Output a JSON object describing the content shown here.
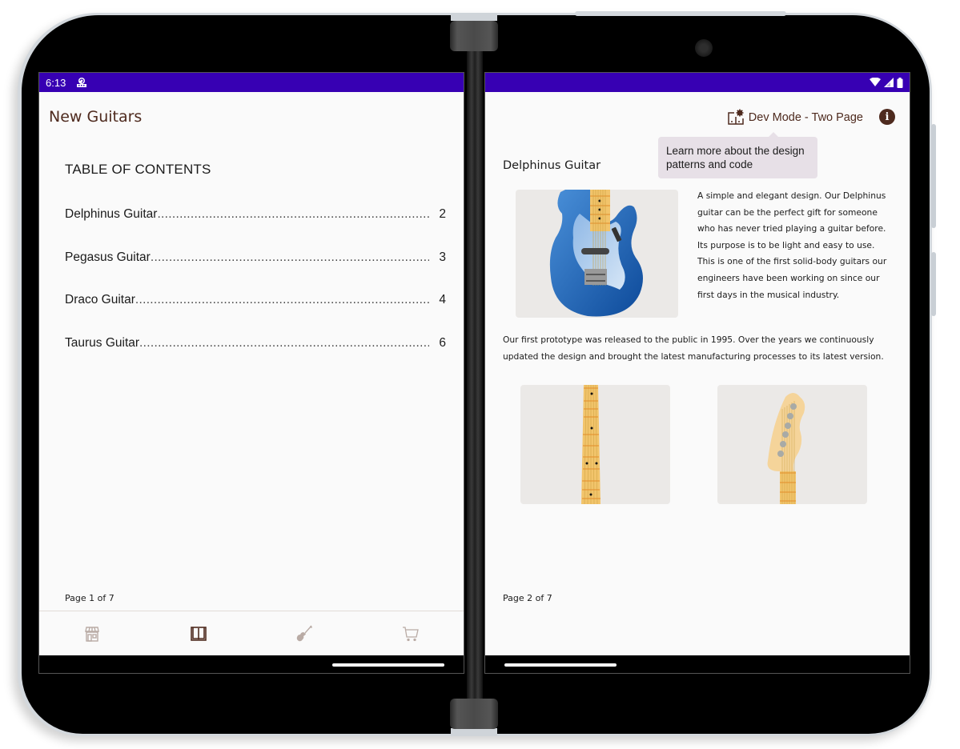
{
  "left_screen": {
    "status_bar": {
      "time": "6:13",
      "notification_icon": "debug-notification-icon"
    },
    "app_title": "New Guitars",
    "toc": {
      "heading": "TABLE OF CONTENTS",
      "items": [
        {
          "label": "Delphinus Guitar",
          "page": "2"
        },
        {
          "label": "Pegasus Guitar",
          "page": "3"
        },
        {
          "label": "Draco Guitar",
          "page": "4"
        },
        {
          "label": "Taurus Guitar",
          "page": "6"
        }
      ]
    },
    "page_indicator": "Page 1 of 7",
    "bottom_nav": [
      {
        "name": "store",
        "icon": "storefront-icon",
        "active": false
      },
      {
        "name": "catalog",
        "icon": "book-icon",
        "active": true
      },
      {
        "name": "customize",
        "icon": "guitar-icon",
        "active": false
      },
      {
        "name": "cart",
        "icon": "cart-icon",
        "active": false
      }
    ]
  },
  "right_screen": {
    "status_bar": {
      "icons": [
        "wifi-icon",
        "signal-icon",
        "battery-icon"
      ]
    },
    "dev_mode": {
      "label": "Dev Mode - Two Page",
      "icon": "dev-mode-icon"
    },
    "info_button": {
      "icon": "info-icon",
      "glyph": "i"
    },
    "tooltip": "Learn more about the design patterns and code",
    "article": {
      "title": "Delphinus Guitar",
      "hero_text": "A simple and elegant design. Our Delphinus guitar can be the perfect gift for someone who has never tried playing a guitar before. Its purpose is to be light and easy to use. This is one of the first solid-body guitars our engineers have been working on since our first days in the musical industry.",
      "body_text": "Our first prototype was released to the public in 1995. Over the years we continuously updated the design and brought the latest manufacturing processes to its latest version.",
      "images": [
        "guitar-body-image",
        "guitar-fretboard-image",
        "guitar-headstock-image"
      ]
    },
    "page_indicator": "Page 2 of 7"
  },
  "colors": {
    "status_bar": "#3700b3",
    "brand_brown": "#4e2a1e",
    "page_bg": "#fafafa",
    "tooltip_bg": "#e7e0e7",
    "inactive_icon": "#b9aba5"
  }
}
